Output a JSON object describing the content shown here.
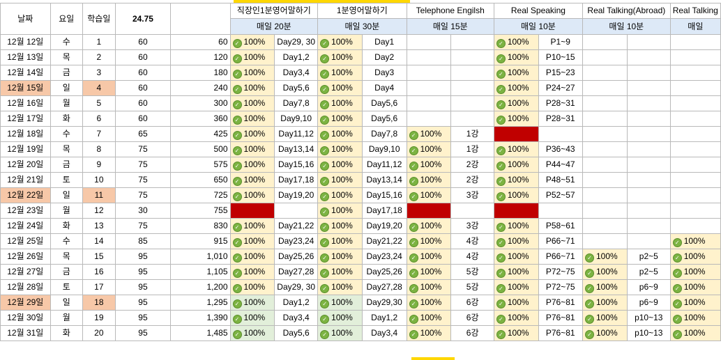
{
  "header": {
    "date_label": "날짜",
    "weekday_label": "요일",
    "day_label": "학습일",
    "total_value": "24.75",
    "sections": [
      {
        "title": "직장인1분영어말하기",
        "sub": "매일 20분"
      },
      {
        "title": "1분영어말하기",
        "sub": "매일 30분"
      },
      {
        "title": "Telephone Engilsh",
        "sub": "매일 15분"
      },
      {
        "title": "Real Speaking",
        "sub": "매일 10분"
      },
      {
        "title": "Real Talking(Abroad)",
        "sub": "매일 10분"
      },
      {
        "title": "Real Talking",
        "sub": "매일"
      }
    ]
  },
  "colors": {
    "sunday": "#f7c8a8",
    "missed": "#c00000",
    "done_yellow": "#fff2cc",
    "done_green": "#e2efda",
    "header_blue": "#dde9f7",
    "check": "#7cb342"
  },
  "check_icon": "check-circle-icon",
  "rows": [
    {
      "date": "12월 12일",
      "wd": "수",
      "n": "1",
      "min": "60",
      "cum": "60",
      "s1": [
        "100%",
        "Day29, 30"
      ],
      "s2": [
        "100%",
        "Day1"
      ],
      "s3": [
        "",
        ""
      ],
      "s4": [
        "100%",
        "P1~9"
      ],
      "s5": [
        "",
        ""
      ],
      "s6": [
        ""
      ]
    },
    {
      "date": "12월 13일",
      "wd": "목",
      "n": "2",
      "min": "60",
      "cum": "120",
      "s1": [
        "100%",
        "Day1,2"
      ],
      "s2": [
        "100%",
        "Day2"
      ],
      "s3": [
        "",
        ""
      ],
      "s4": [
        "100%",
        "P10~15"
      ],
      "s5": [
        "",
        ""
      ],
      "s6": [
        ""
      ]
    },
    {
      "date": "12월 14일",
      "wd": "금",
      "n": "3",
      "min": "60",
      "cum": "180",
      "s1": [
        "100%",
        "Day3,4"
      ],
      "s2": [
        "100%",
        "Day3"
      ],
      "s3": [
        "",
        ""
      ],
      "s4": [
        "100%",
        "P15~23"
      ],
      "s5": [
        "",
        ""
      ],
      "s6": [
        ""
      ]
    },
    {
      "date": "12월 15일",
      "wd": "일",
      "n": "4",
      "min": "60",
      "cum": "240",
      "sun": true,
      "s1": [
        "100%",
        "Day5,6"
      ],
      "s2": [
        "100%",
        "Day4"
      ],
      "s3": [
        "",
        ""
      ],
      "s4": [
        "100%",
        "P24~27"
      ],
      "s5": [
        "",
        ""
      ],
      "s6": [
        ""
      ]
    },
    {
      "date": "12월 16일",
      "wd": "월",
      "n": "5",
      "min": "60",
      "cum": "300",
      "s1": [
        "100%",
        "Day7,8"
      ],
      "s2": [
        "100%",
        "Day5,6"
      ],
      "s3": [
        "",
        ""
      ],
      "s4": [
        "100%",
        "P28~31"
      ],
      "s5": [
        "",
        ""
      ],
      "s6": [
        ""
      ]
    },
    {
      "date": "12월 17일",
      "wd": "화",
      "n": "6",
      "min": "60",
      "cum": "360",
      "s1": [
        "100%",
        "Day9,10"
      ],
      "s2": [
        "100%",
        "Day5,6"
      ],
      "s3": [
        "",
        ""
      ],
      "s4": [
        "100%",
        "P28~31"
      ],
      "s5": [
        "",
        ""
      ],
      "s6": [
        ""
      ]
    },
    {
      "date": "12월 18일",
      "wd": "수",
      "n": "7",
      "min": "65",
      "cum": "425",
      "s1": [
        "100%",
        "Day11,12"
      ],
      "s2": [
        "100%",
        "Day7,8"
      ],
      "s3": [
        "100%",
        "1강"
      ],
      "s4": [
        "RED",
        ""
      ],
      "s5": [
        "",
        ""
      ],
      "s6": [
        ""
      ]
    },
    {
      "date": "12월 19일",
      "wd": "목",
      "n": "8",
      "min": "75",
      "cum": "500",
      "s1": [
        "100%",
        "Day13,14"
      ],
      "s2": [
        "100%",
        "Day9,10"
      ],
      "s3": [
        "100%",
        "1강"
      ],
      "s4": [
        "100%",
        "P36~43"
      ],
      "s5": [
        "",
        ""
      ],
      "s6": [
        ""
      ]
    },
    {
      "date": "12월 20일",
      "wd": "금",
      "n": "9",
      "min": "75",
      "cum": "575",
      "s1": [
        "100%",
        "Day15,16"
      ],
      "s2": [
        "100%",
        "Day11,12"
      ],
      "s3": [
        "100%",
        "2강"
      ],
      "s4": [
        "100%",
        "P44~47"
      ],
      "s5": [
        "",
        ""
      ],
      "s6": [
        ""
      ]
    },
    {
      "date": "12월 21일",
      "wd": "토",
      "n": "10",
      "min": "75",
      "cum": "650",
      "s1": [
        "100%",
        "Day17,18"
      ],
      "s2": [
        "100%",
        "Day13,14"
      ],
      "s3": [
        "100%",
        "2강"
      ],
      "s4": [
        "100%",
        "P48~51"
      ],
      "s5": [
        "",
        ""
      ],
      "s6": [
        ""
      ]
    },
    {
      "date": "12월 22일",
      "wd": "일",
      "n": "11",
      "min": "75",
      "cum": "725",
      "sun": true,
      "s1": [
        "100%",
        "Day19,20"
      ],
      "s2": [
        "100%",
        "Day15,16"
      ],
      "s3": [
        "100%",
        "3강"
      ],
      "s4": [
        "100%",
        "P52~57"
      ],
      "s5": [
        "",
        ""
      ],
      "s6": [
        ""
      ]
    },
    {
      "date": "12월 23일",
      "wd": "월",
      "n": "12",
      "min": "30",
      "cum": "755",
      "s1": [
        "RED",
        ""
      ],
      "s2": [
        "100%",
        "Day17,18"
      ],
      "s3": [
        "RED",
        ""
      ],
      "s4": [
        "RED",
        ""
      ],
      "s5": [
        "",
        ""
      ],
      "s6": [
        ""
      ]
    },
    {
      "date": "12월 24일",
      "wd": "화",
      "n": "13",
      "min": "75",
      "cum": "830",
      "s1": [
        "100%",
        "Day21,22"
      ],
      "s2": [
        "100%",
        "Day19,20"
      ],
      "s3": [
        "100%",
        "3강"
      ],
      "s4": [
        "100%",
        "P58~61"
      ],
      "s5": [
        "",
        ""
      ],
      "s6": [
        ""
      ]
    },
    {
      "date": "12월 25일",
      "wd": "수",
      "n": "14",
      "min": "85",
      "cum": "915",
      "s1": [
        "100%",
        "Day23,24"
      ],
      "s2": [
        "100%",
        "Day21,22"
      ],
      "s3": [
        "100%",
        "4강"
      ],
      "s4": [
        "100%",
        "P66~71"
      ],
      "s5": [
        "",
        ""
      ],
      "s6": [
        "100%"
      ]
    },
    {
      "date": "12월 26일",
      "wd": "목",
      "n": "15",
      "min": "95",
      "cum": "1,010",
      "s1": [
        "100%",
        "Day25,26"
      ],
      "s2": [
        "100%",
        "Day23,24"
      ],
      "s3": [
        "100%",
        "4강"
      ],
      "s4": [
        "100%",
        "P66~71"
      ],
      "s5": [
        "100%",
        "p2~5"
      ],
      "s6": [
        "100%"
      ]
    },
    {
      "date": "12월 27일",
      "wd": "금",
      "n": "16",
      "min": "95",
      "cum": "1,105",
      "s1": [
        "100%",
        "Day27,28"
      ],
      "s2": [
        "100%",
        "Day25,26"
      ],
      "s3": [
        "100%",
        "5강"
      ],
      "s4": [
        "100%",
        "P72~75"
      ],
      "s5": [
        "100%",
        "p2~5"
      ],
      "s6": [
        "100%"
      ]
    },
    {
      "date": "12월 28일",
      "wd": "토",
      "n": "17",
      "min": "95",
      "cum": "1,200",
      "s1": [
        "100%",
        "Day29, 30"
      ],
      "s2": [
        "100%",
        "Day27,28"
      ],
      "s3": [
        "100%",
        "5강"
      ],
      "s4": [
        "100%",
        "P72~75"
      ],
      "s5": [
        "100%",
        "p6~9"
      ],
      "s6": [
        "100%"
      ]
    },
    {
      "date": "12월 29일",
      "wd": "일",
      "n": "18",
      "min": "95",
      "cum": "1,295",
      "sun": true,
      "g1": true,
      "g2": true,
      "s1": [
        "100%",
        "Day1,2"
      ],
      "s2": [
        "100%",
        "Day29,30"
      ],
      "s3": [
        "100%",
        "6강"
      ],
      "s4": [
        "100%",
        "P76~81"
      ],
      "s5": [
        "100%",
        "p6~9"
      ],
      "s6": [
        "100%"
      ]
    },
    {
      "date": "12월 30일",
      "wd": "월",
      "n": "19",
      "min": "95",
      "cum": "1,390",
      "g1": true,
      "g2": true,
      "s1": [
        "100%",
        "Day3,4"
      ],
      "s2": [
        "100%",
        "Day1,2"
      ],
      "s3": [
        "100%",
        "6강"
      ],
      "s4": [
        "100%",
        "P76~81"
      ],
      "s5": [
        "100%",
        "p10~13"
      ],
      "s6": [
        "100%"
      ]
    },
    {
      "date": "12월 31일",
      "wd": "화",
      "n": "20",
      "min": "95",
      "cum": "1,485",
      "g1": true,
      "g2": true,
      "s1": [
        "100%",
        "Day5,6"
      ],
      "s2": [
        "100%",
        "Day3,4"
      ],
      "s3": [
        "100%",
        "6강"
      ],
      "s4": [
        "100%",
        "P76~81"
      ],
      "s5": [
        "100%",
        "p10~13"
      ],
      "s6": [
        "100%"
      ]
    }
  ]
}
